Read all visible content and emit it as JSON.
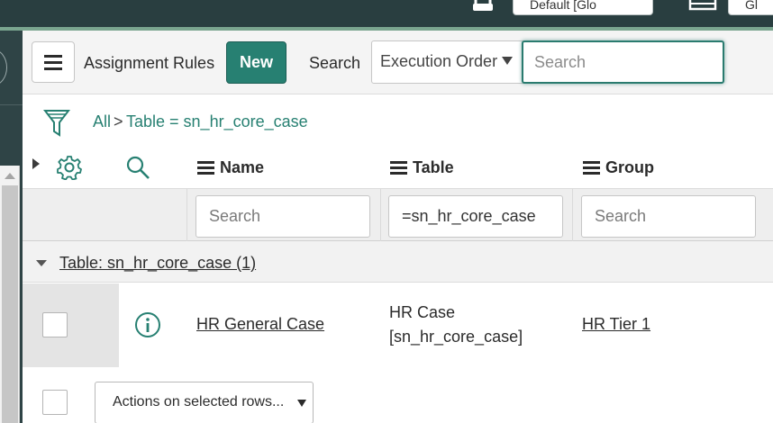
{
  "banner": {
    "select_value": "Default [Glo",
    "second_button": "Gl"
  },
  "header": {
    "title": "Assignment Rules",
    "new_button": "New",
    "search_label": "Search",
    "search_field_select": "Execution Order",
    "search_placeholder": "Search",
    "search_value": ""
  },
  "breadcrumb": {
    "all": "All",
    "separator": ">",
    "condition": "Table = sn_hr_core_case"
  },
  "columns": [
    {
      "label": "Name",
      "filter_value": "",
      "filter_placeholder": "Search"
    },
    {
      "label": "Table",
      "filter_value": "=sn_hr_core_case",
      "filter_placeholder": "Search"
    },
    {
      "label": "Group",
      "filter_value": "",
      "filter_placeholder": "Search"
    }
  ],
  "group": {
    "label": "Table: sn_hr_core_case (1)"
  },
  "rows": [
    {
      "name": "HR General Case",
      "table_line1": "HR Case",
      "table_line2": "[sn_hr_core_case]",
      "group": "HR Tier 1"
    }
  ],
  "footer": {
    "actions_label": "Actions on selected rows..."
  },
  "colors": {
    "banner": "#293e40",
    "accent": "#278072",
    "link": "#278072"
  },
  "icons": {
    "menu": "hamburger-icon",
    "filter": "filter-funnel-icon",
    "settings": "gear-icon",
    "search": "magnifier-icon",
    "info": "info-circle-icon"
  }
}
